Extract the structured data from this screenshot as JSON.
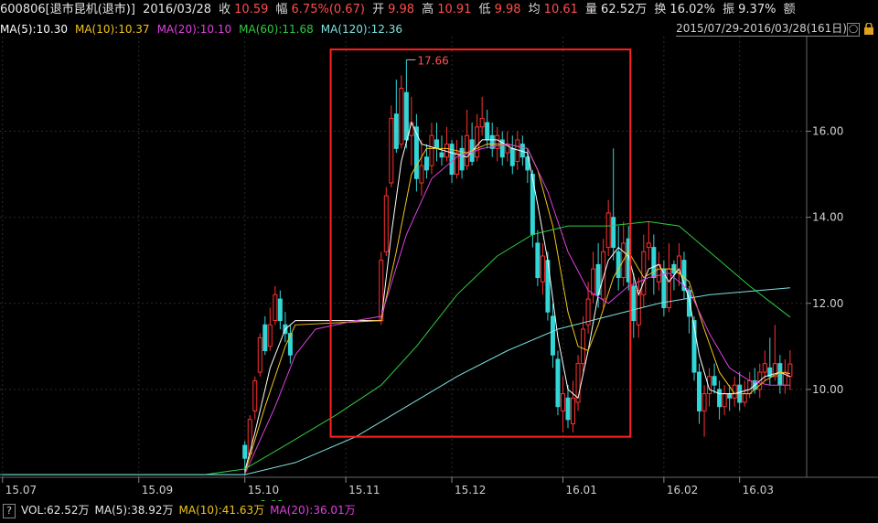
{
  "header": {
    "code": "600806[退市昆机(退市)]",
    "date": "2016/03/28",
    "close_label": "收",
    "close": "10.59",
    "change_label": "幅",
    "change": "6.75%(0.67)",
    "open_label": "开",
    "open": "9.98",
    "high_label": "高",
    "high": "10.91",
    "low_label": "低",
    "low": "9.98",
    "avg_label": "均",
    "avg": "10.61",
    "volume_label": "量",
    "volume": "62.52万",
    "turnover_label": "换",
    "turnover": "16.02%",
    "amplitude_label": "振",
    "amplitude": "9.37%",
    "amount_label": "额"
  },
  "ma_bar": {
    "items": [
      {
        "text": "MA(5):10.30",
        "color": "#ffffff"
      },
      {
        "text": "MA(10):10.37",
        "color": "#f0c419"
      },
      {
        "text": "MA(20):10.10",
        "color": "#e040e0"
      },
      {
        "text": "MA(60):11.68",
        "color": "#2ecc40"
      },
      {
        "text": "MA(120):12.36",
        "color": "#7fe0e0"
      }
    ],
    "range": "2015/07/29-2016/03/28(161日)",
    "range_button": "◯"
  },
  "vol_bar": {
    "q_label": "?",
    "items": [
      {
        "text": "VOL:62.52万",
        "color": "#e6e6e6"
      },
      {
        "text": "MA(5):38.92万",
        "color": "#e6e6e6"
      },
      {
        "text": "MA(10):41.63万",
        "color": "#f0c419"
      },
      {
        "text": "MA(20):36.01万",
        "color": "#e040e0"
      }
    ]
  },
  "chart_data": {
    "type": "candlestick",
    "y_ticks": [
      "16.00",
      "14.00",
      "12.00",
      "10.00"
    ],
    "y_tick_values": [
      16,
      14,
      12,
      10
    ],
    "ylim": [
      8.0,
      18.2
    ],
    "x_ticks": [
      {
        "label": "15.07",
        "index": 0
      },
      {
        "label": "15.09",
        "index": 27
      },
      {
        "label": "15.10",
        "index": 48
      },
      {
        "label": "15.11",
        "index": 68
      },
      {
        "label": "15.12",
        "index": 89
      },
      {
        "label": "16.01",
        "index": 111
      },
      {
        "label": "16.02",
        "index": 131
      },
      {
        "label": "16.03",
        "index": 146
      }
    ],
    "max_label": "17.66",
    "min_label": "8.02",
    "colors": {
      "up": "#ff3030",
      "down": "#33d6d6",
      "box": "#ff2020"
    },
    "candles": [
      [
        48,
        8.7,
        8.4,
        8.8,
        8.0
      ],
      [
        49,
        8.5,
        9.3,
        9.4,
        8.4
      ],
      [
        50,
        9.5,
        10.2,
        10.3,
        9.3
      ],
      [
        51,
        10.4,
        11.2,
        11.3,
        10.3
      ],
      [
        52,
        11.5,
        10.9,
        11.7,
        10.8
      ],
      [
        53,
        11.0,
        11.5,
        11.9,
        10.9
      ],
      [
        54,
        11.6,
        12.2,
        12.4,
        11.5
      ],
      [
        55,
        12.1,
        11.6,
        12.3,
        11.4
      ],
      [
        56,
        11.5,
        11.3,
        11.8,
        11.1
      ],
      [
        57,
        11.3,
        10.8,
        11.5,
        10.6
      ],
      [
        75,
        11.6,
        13.0,
        13.2,
        11.5
      ],
      [
        76,
        13.2,
        14.5,
        14.7,
        13.1
      ],
      [
        77,
        14.8,
        16.3,
        16.6,
        14.7
      ],
      [
        78,
        16.4,
        15.6,
        17.2,
        15.5
      ],
      [
        79,
        15.7,
        17.0,
        17.3,
        15.6
      ],
      [
        80,
        16.9,
        15.8,
        17.66,
        15.6
      ],
      [
        81,
        15.9,
        16.2,
        16.8,
        15.2
      ],
      [
        82,
        16.1,
        14.9,
        16.4,
        14.6
      ],
      [
        83,
        14.8,
        15.2,
        15.8,
        14.5
      ],
      [
        84,
        15.4,
        15.1,
        15.7,
        14.9
      ],
      [
        85,
        15.2,
        15.9,
        16.2,
        15.0
      ],
      [
        86,
        15.8,
        15.6,
        16.2,
        15.3
      ],
      [
        87,
        15.5,
        15.4,
        15.9,
        15.2
      ],
      [
        88,
        15.4,
        15.7,
        16.1,
        15.3
      ],
      [
        89,
        15.7,
        15.0,
        15.8,
        14.8
      ],
      [
        90,
        15.0,
        15.5,
        15.8,
        14.9
      ],
      [
        91,
        15.6,
        15.1,
        15.9,
        14.9
      ],
      [
        92,
        15.2,
        15.9,
        16.5,
        15.1
      ],
      [
        93,
        15.8,
        15.3,
        16.2,
        15.2
      ],
      [
        94,
        15.4,
        16.1,
        16.4,
        15.3
      ],
      [
        95,
        16.1,
        16.3,
        16.8,
        15.9
      ],
      [
        96,
        16.2,
        15.8,
        16.5,
        15.6
      ],
      [
        97,
        15.9,
        15.6,
        16.2,
        15.4
      ],
      [
        98,
        15.6,
        15.9,
        16.1,
        15.3
      ],
      [
        99,
        15.8,
        15.4,
        16.0,
        15.2
      ],
      [
        100,
        15.5,
        15.7,
        16.0,
        15.3
      ],
      [
        101,
        15.6,
        15.2,
        15.9,
        15.0
      ],
      [
        102,
        15.3,
        15.8,
        16.0,
        15.1
      ],
      [
        103,
        15.7,
        15.4,
        15.9,
        15.2
      ],
      [
        104,
        15.4,
        15.1,
        15.6,
        14.8
      ],
      [
        105,
        15.0,
        13.6,
        15.1,
        13.3
      ],
      [
        106,
        13.4,
        12.6,
        13.7,
        12.4
      ],
      [
        107,
        12.5,
        13.1,
        13.4,
        12.2
      ],
      [
        108,
        13.0,
        11.8,
        13.2,
        11.6
      ],
      [
        109,
        11.7,
        10.8,
        12.0,
        10.5
      ],
      [
        110,
        10.7,
        9.6,
        10.9,
        9.4
      ],
      [
        111,
        9.5,
        9.9,
        10.3,
        9.0
      ],
      [
        112,
        9.8,
        9.3,
        10.1,
        9.1
      ],
      [
        113,
        9.2,
        9.8,
        10.2,
        9.0
      ],
      [
        114,
        9.7,
        10.6,
        10.8,
        9.5
      ],
      [
        115,
        10.6,
        11.4,
        11.7,
        10.4
      ],
      [
        116,
        11.5,
        12.1,
        12.5,
        11.3
      ],
      [
        117,
        12.2,
        12.8,
        13.2,
        12.0
      ],
      [
        118,
        12.9,
        12.2,
        13.4,
        11.9
      ],
      [
        119,
        12.1,
        13.2,
        13.5,
        11.9
      ],
      [
        120,
        13.3,
        14.1,
        14.4,
        13.1
      ],
      [
        121,
        14.0,
        13.3,
        15.6,
        13.0
      ],
      [
        122,
        13.2,
        12.6,
        13.8,
        12.3
      ],
      [
        123,
        12.6,
        13.4,
        13.9,
        12.4
      ],
      [
        124,
        13.5,
        12.5,
        13.8,
        12.3
      ],
      [
        125,
        12.4,
        11.6,
        12.7,
        11.2
      ],
      [
        126,
        11.5,
        12.3,
        12.6,
        11.2
      ],
      [
        127,
        12.2,
        13.2,
        13.6,
        11.9
      ],
      [
        128,
        13.3,
        13.4,
        13.9,
        13.0
      ],
      [
        129,
        13.3,
        12.6,
        13.6,
        12.2
      ],
      [
        130,
        12.5,
        12.9,
        13.2,
        12.3
      ],
      [
        131,
        12.8,
        11.9,
        13.0,
        11.7
      ],
      [
        132,
        11.9,
        12.8,
        13.4,
        11.8
      ],
      [
        133,
        12.9,
        12.7,
        13.0,
        12.3
      ],
      [
        134,
        12.7,
        13.1,
        13.4,
        12.4
      ],
      [
        135,
        13.0,
        12.3,
        13.2,
        12.1
      ],
      [
        136,
        12.3,
        11.7,
        12.4,
        11.3
      ],
      [
        137,
        11.6,
        10.4,
        11.7,
        10.2
      ],
      [
        138,
        10.4,
        9.5,
        10.6,
        9.2
      ],
      [
        139,
        9.5,
        9.9,
        10.1,
        8.9
      ],
      [
        140,
        9.9,
        10.3,
        10.5,
        9.6
      ],
      [
        141,
        10.3,
        10.1,
        10.6,
        9.9
      ],
      [
        142,
        10.0,
        9.6,
        10.2,
        9.3
      ],
      [
        143,
        9.6,
        9.9,
        10.1,
        9.4
      ],
      [
        144,
        9.9,
        9.8,
        10.1,
        9.5
      ],
      [
        145,
        9.8,
        10.1,
        10.3,
        9.6
      ],
      [
        146,
        10.1,
        9.7,
        10.4,
        9.5
      ],
      [
        147,
        9.7,
        9.9,
        10.2,
        9.6
      ],
      [
        148,
        9.9,
        10.2,
        10.4,
        9.8
      ],
      [
        149,
        10.2,
        10.0,
        10.5,
        9.9
      ],
      [
        150,
        10.0,
        10.4,
        10.6,
        9.8
      ],
      [
        151,
        10.4,
        10.6,
        10.9,
        10.2
      ],
      [
        152,
        10.5,
        10.3,
        11.2,
        10.1
      ],
      [
        153,
        10.3,
        10.6,
        11.5,
        10.2
      ],
      [
        154,
        10.6,
        10.1,
        10.8,
        9.9
      ],
      [
        155,
        10.1,
        10.4,
        10.7,
        9.9
      ],
      [
        156,
        10.3,
        10.59,
        10.91,
        9.98
      ]
    ],
    "flat_price": 8.02,
    "flat_range": [
      0,
      48
    ],
    "gap_price": 11.6,
    "gap_range": [
      58,
      75
    ],
    "series": [
      {
        "name": "MA(5)",
        "color": "#ffffff",
        "points": [
          [
            48,
            8.1
          ],
          [
            50,
            9.0
          ],
          [
            53,
            10.5
          ],
          [
            56,
            11.4
          ],
          [
            58,
            11.6
          ],
          [
            75,
            11.6
          ],
          [
            77,
            13.6
          ],
          [
            79,
            15.3
          ],
          [
            81,
            16.2
          ],
          [
            83,
            15.7
          ],
          [
            86,
            15.6
          ],
          [
            89,
            15.5
          ],
          [
            92,
            15.4
          ],
          [
            95,
            15.8
          ],
          [
            98,
            15.8
          ],
          [
            101,
            15.6
          ],
          [
            104,
            15.5
          ],
          [
            106,
            14.3
          ],
          [
            108,
            13.0
          ],
          [
            110,
            11.2
          ],
          [
            112,
            10.0
          ],
          [
            114,
            9.8
          ],
          [
            116,
            10.9
          ],
          [
            118,
            12.2
          ],
          [
            120,
            13.0
          ],
          [
            122,
            13.3
          ],
          [
            124,
            13.1
          ],
          [
            126,
            12.2
          ],
          [
            128,
            12.8
          ],
          [
            130,
            12.9
          ],
          [
            132,
            12.5
          ],
          [
            134,
            12.8
          ],
          [
            136,
            12.1
          ],
          [
            138,
            10.8
          ],
          [
            140,
            10.0
          ],
          [
            142,
            9.9
          ],
          [
            145,
            9.9
          ],
          [
            148,
            10.0
          ],
          [
            151,
            10.3
          ],
          [
            154,
            10.4
          ],
          [
            156,
            10.3
          ]
        ]
      },
      {
        "name": "MA(10)",
        "color": "#f0c419",
        "points": [
          [
            48,
            8.05
          ],
          [
            52,
            9.6
          ],
          [
            56,
            11.0
          ],
          [
            58,
            11.5
          ],
          [
            75,
            11.6
          ],
          [
            78,
            13.2
          ],
          [
            81,
            15.0
          ],
          [
            84,
            15.6
          ],
          [
            88,
            15.6
          ],
          [
            92,
            15.5
          ],
          [
            96,
            15.7
          ],
          [
            100,
            15.7
          ],
          [
            104,
            15.6
          ],
          [
            106,
            15.1
          ],
          [
            109,
            13.8
          ],
          [
            112,
            11.8
          ],
          [
            114,
            11.0
          ],
          [
            116,
            10.9
          ],
          [
            118,
            11.5
          ],
          [
            121,
            12.6
          ],
          [
            124,
            13.2
          ],
          [
            127,
            12.6
          ],
          [
            130,
            12.8
          ],
          [
            133,
            12.8
          ],
          [
            136,
            12.5
          ],
          [
            139,
            11.4
          ],
          [
            142,
            10.4
          ],
          [
            145,
            9.9
          ],
          [
            148,
            9.9
          ],
          [
            151,
            10.2
          ],
          [
            154,
            10.4
          ],
          [
            156,
            10.37
          ]
        ]
      },
      {
        "name": "MA(20)",
        "color": "#e040e0",
        "points": [
          [
            48,
            8.03
          ],
          [
            54,
            9.6
          ],
          [
            58,
            10.8
          ],
          [
            62,
            11.4
          ],
          [
            70,
            11.6
          ],
          [
            75,
            11.7
          ],
          [
            80,
            13.6
          ],
          [
            85,
            14.9
          ],
          [
            90,
            15.4
          ],
          [
            95,
            15.6
          ],
          [
            100,
            15.7
          ],
          [
            104,
            15.6
          ],
          [
            108,
            14.6
          ],
          [
            112,
            13.2
          ],
          [
            116,
            12.3
          ],
          [
            120,
            12.0
          ],
          [
            124,
            12.4
          ],
          [
            128,
            12.6
          ],
          [
            132,
            12.7
          ],
          [
            136,
            12.3
          ],
          [
            140,
            11.3
          ],
          [
            144,
            10.5
          ],
          [
            148,
            10.2
          ],
          [
            152,
            10.1
          ],
          [
            156,
            10.1
          ]
        ]
      },
      {
        "name": "MA(60)",
        "color": "#2ecc40",
        "points": [
          [
            0,
            8.02
          ],
          [
            40,
            8.02
          ],
          [
            48,
            8.15
          ],
          [
            56,
            8.7
          ],
          [
            66,
            9.4
          ],
          [
            75,
            10.1
          ],
          [
            82,
            11.0
          ],
          [
            90,
            12.2
          ],
          [
            98,
            13.1
          ],
          [
            105,
            13.6
          ],
          [
            112,
            13.8
          ],
          [
            120,
            13.8
          ],
          [
            128,
            13.9
          ],
          [
            134,
            13.8
          ],
          [
            140,
            13.2
          ],
          [
            148,
            12.4
          ],
          [
            156,
            11.68
          ]
        ]
      },
      {
        "name": "MA(120)",
        "color": "#7fe0e0",
        "points": [
          [
            0,
            8.02
          ],
          [
            48,
            8.02
          ],
          [
            58,
            8.3
          ],
          [
            70,
            8.9
          ],
          [
            80,
            9.6
          ],
          [
            90,
            10.3
          ],
          [
            100,
            10.9
          ],
          [
            110,
            11.4
          ],
          [
            120,
            11.7
          ],
          [
            130,
            12.0
          ],
          [
            140,
            12.2
          ],
          [
            150,
            12.3
          ],
          [
            156,
            12.36
          ]
        ]
      }
    ]
  }
}
